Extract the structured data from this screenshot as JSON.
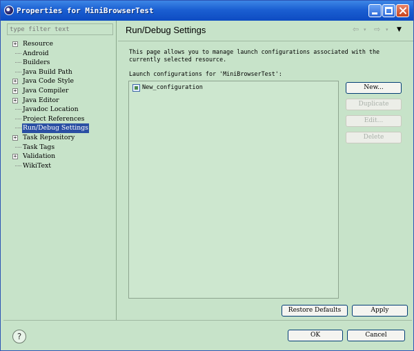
{
  "window": {
    "title": "Properties for MiniBrowserTest",
    "controls": {
      "minimize": "minimize",
      "maximize": "maximize",
      "close": "close"
    }
  },
  "sidebar": {
    "filter_placeholder": "type filter text",
    "items": [
      {
        "label": "Resource",
        "expandable": true
      },
      {
        "label": "Android",
        "expandable": false
      },
      {
        "label": "Builders",
        "expandable": false
      },
      {
        "label": "Java Build Path",
        "expandable": false
      },
      {
        "label": "Java Code Style",
        "expandable": true
      },
      {
        "label": "Java Compiler",
        "expandable": true
      },
      {
        "label": "Java Editor",
        "expandable": true
      },
      {
        "label": "Javadoc Location",
        "expandable": false
      },
      {
        "label": "Project References",
        "expandable": false
      },
      {
        "label": "Run/Debug Settings",
        "expandable": false,
        "selected": true
      },
      {
        "label": "Task Repository",
        "expandable": true
      },
      {
        "label": "Task Tags",
        "expandable": false
      },
      {
        "label": "Validation",
        "expandable": true
      },
      {
        "label": "WikiText",
        "expandable": false
      }
    ]
  },
  "main": {
    "heading": "Run/Debug Settings",
    "description": "This page allows you to manage launch configurations associated with the currently selected resource.",
    "list_label": "Launch configurations for 'MiniBrowserTest':",
    "configurations": [
      "New_configuration"
    ],
    "buttons": {
      "new": "New...",
      "duplicate": "Duplicate",
      "edit": "Edit...",
      "delete": "Delete",
      "restore_defaults": "Restore Defaults",
      "apply": "Apply"
    }
  },
  "footer": {
    "help": "?",
    "ok": "OK",
    "cancel": "Cancel"
  }
}
